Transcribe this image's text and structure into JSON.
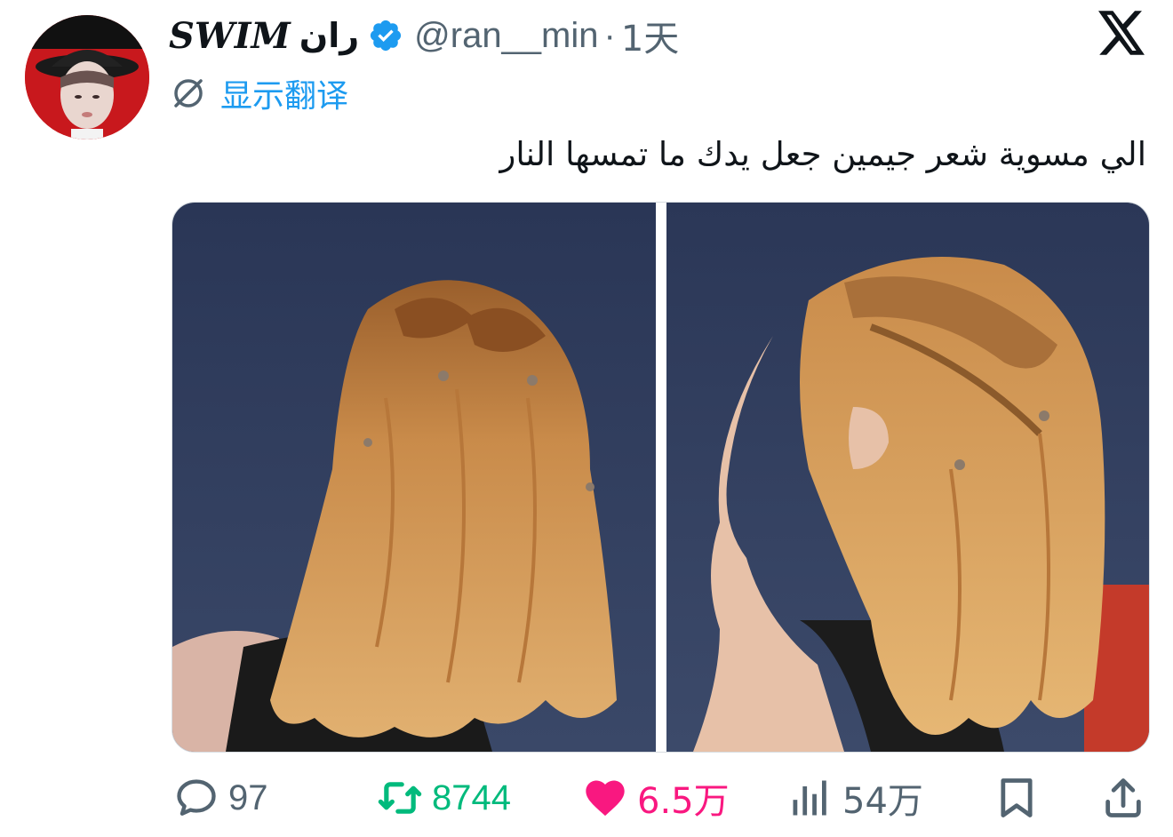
{
  "tweet": {
    "display_name": "SWIM",
    "display_name_arabic": "ران",
    "verified": true,
    "handle": "@ran__min",
    "separator": "·",
    "time": "1天",
    "brand_icon": "x-logo-icon",
    "translate_label": "显示翻译",
    "text": "الي مسوية شعر جيمين جعل يدك ما تمسها النار",
    "media": {
      "image_count": 2,
      "images": [
        {
          "name": "back-view-braided-hair-photo"
        },
        {
          "name": "side-profile-braided-hair-photo"
        }
      ]
    }
  },
  "actions": {
    "reply": {
      "icon": "reply-icon",
      "count": "97"
    },
    "retweet": {
      "icon": "retweet-icon",
      "count": "8744"
    },
    "like": {
      "icon": "heart-icon",
      "count": "6.5万"
    },
    "views": {
      "icon": "views-chart-icon",
      "count": "54万"
    },
    "bookmark": {
      "icon": "bookmark-icon"
    },
    "share": {
      "icon": "share-icon"
    }
  },
  "colors": {
    "text_primary": "#0f1419",
    "text_secondary": "#536471",
    "accent_blue": "#1d9bf0",
    "retweet_green": "#00ba7c",
    "like_pink": "#f91880",
    "background": "#ffffff"
  }
}
